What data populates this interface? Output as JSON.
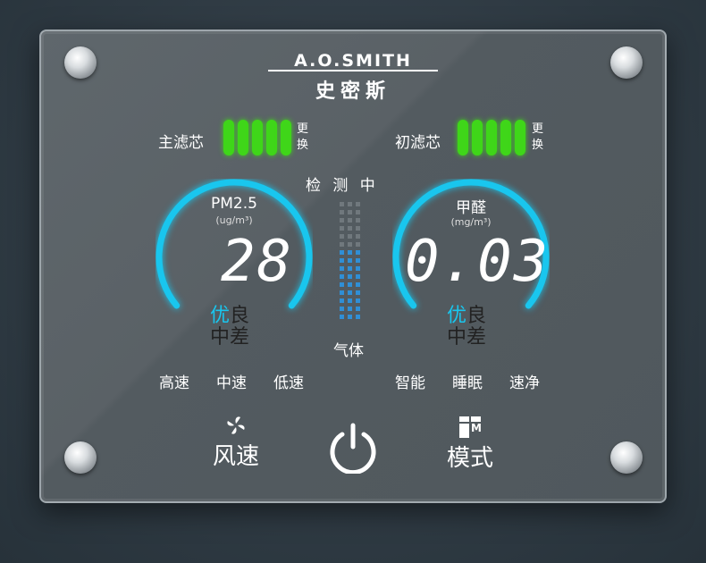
{
  "brand": {
    "en": "A.O.SMITH",
    "cn": "史密斯"
  },
  "filters": [
    {
      "label": "主滤芯",
      "level": 5,
      "max": 5,
      "replace": "更换"
    },
    {
      "label": "初滤芯",
      "level": 5,
      "max": 5,
      "replace": "更换"
    }
  ],
  "status": "检 测 中",
  "gas_label": "气体",
  "gas_level": 0.6,
  "pm25": {
    "title": "PM2.5",
    "unit": "(ug/m³)",
    "value": "28",
    "q1": "优",
    "q2": "良",
    "q3": "中",
    "q4": "差"
  },
  "hcho": {
    "title": "甲醛",
    "unit": "(mg/m³)",
    "value": "0.03",
    "q1": "优",
    "q2": "良",
    "q3": "中",
    "q4": "差"
  },
  "speeds": [
    "高速",
    "中速",
    "低速"
  ],
  "modes": [
    "智能",
    "睡眠",
    "速净"
  ],
  "buttons": {
    "fan": "风速",
    "mode": "模式",
    "mode_icon_letter": "M"
  },
  "colors": {
    "accent": "#19c6ee",
    "filter": "#3fd619"
  }
}
